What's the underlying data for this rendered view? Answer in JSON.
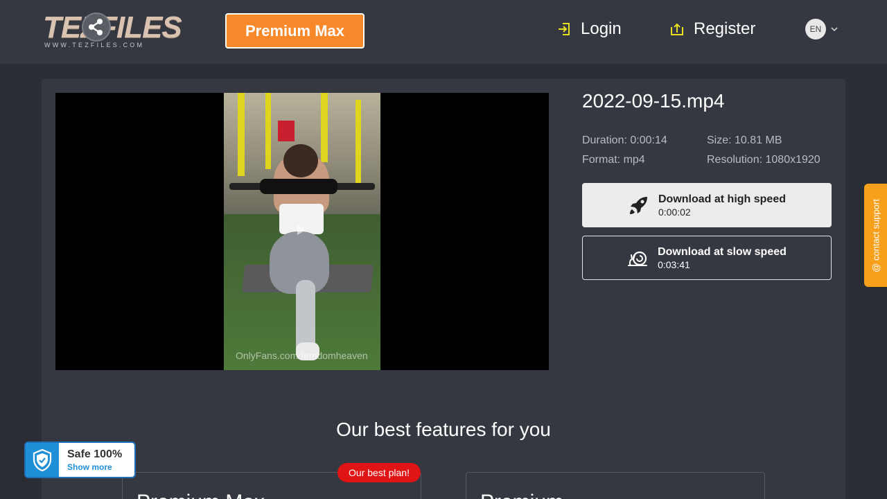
{
  "header": {
    "logo_text": "TEZFILES",
    "logo_subtext": "WWW.TEZFILES.COM",
    "premium_label": "Premium Max",
    "login_label": "Login",
    "register_label": "Register",
    "language": "EN"
  },
  "player": {
    "watermark": "OnlyFans.com/femdomheaven"
  },
  "file": {
    "title": "2022-09-15.mp4",
    "duration": "Duration: 0:00:14",
    "size": "Size: 10.81 MB",
    "format": "Format: mp4",
    "resolution": "Resolution: 1080x1920"
  },
  "downloads": {
    "fast": {
      "label": "Download at high speed",
      "time": "0:00:02"
    },
    "slow": {
      "label": "Download at slow speed",
      "time": "0:03:41"
    }
  },
  "contact_support": "@ contact support",
  "features": {
    "title": "Our best features for you",
    "best_badge": "Our best plan!",
    "plans": [
      "Premium Max",
      "Premium"
    ]
  },
  "safe_badge": {
    "title": "Safe 100%",
    "more": "Show more"
  },
  "colors": {
    "accent_orange": "#f7892b",
    "support_orange": "#f7a01c",
    "badge_red": "#e01414",
    "safe_blue": "#1f8fd8",
    "nav_icon_yellow": "#e8e020"
  }
}
